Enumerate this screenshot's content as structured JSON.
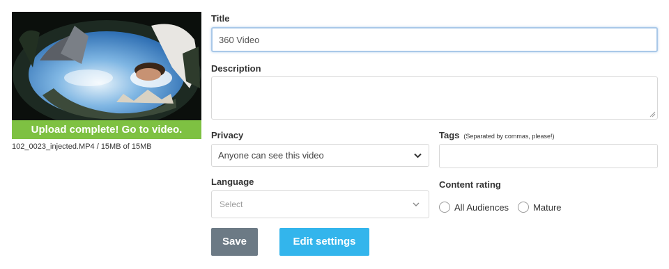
{
  "video": {
    "upload_status": "Upload complete! Go to video.",
    "file_info": "102_0023_injected.MP4 / 15MB of 15MB"
  },
  "form": {
    "title_label": "Title",
    "title_value": "360 Video",
    "description_label": "Description",
    "description_value": "",
    "privacy_label": "Privacy",
    "privacy_selected": "Anyone can see this video",
    "tags_label": "Tags",
    "tags_hint": "(Separated by commas, please!)",
    "tags_value": "",
    "language_label": "Language",
    "language_placeholder": "Select",
    "content_rating_label": "Content rating",
    "content_rating_options": [
      "All Audiences",
      "Mature"
    ]
  },
  "actions": {
    "save_label": "Save",
    "edit_settings_label": "Edit settings"
  },
  "colors": {
    "upload_bar": "#7ec142",
    "save_button": "#6c7a85",
    "edit_button": "#33b5ec",
    "focus_border": "#a9c8e8"
  },
  "icons": [
    "chevron-down-icon",
    "resize-grip-icon"
  ]
}
